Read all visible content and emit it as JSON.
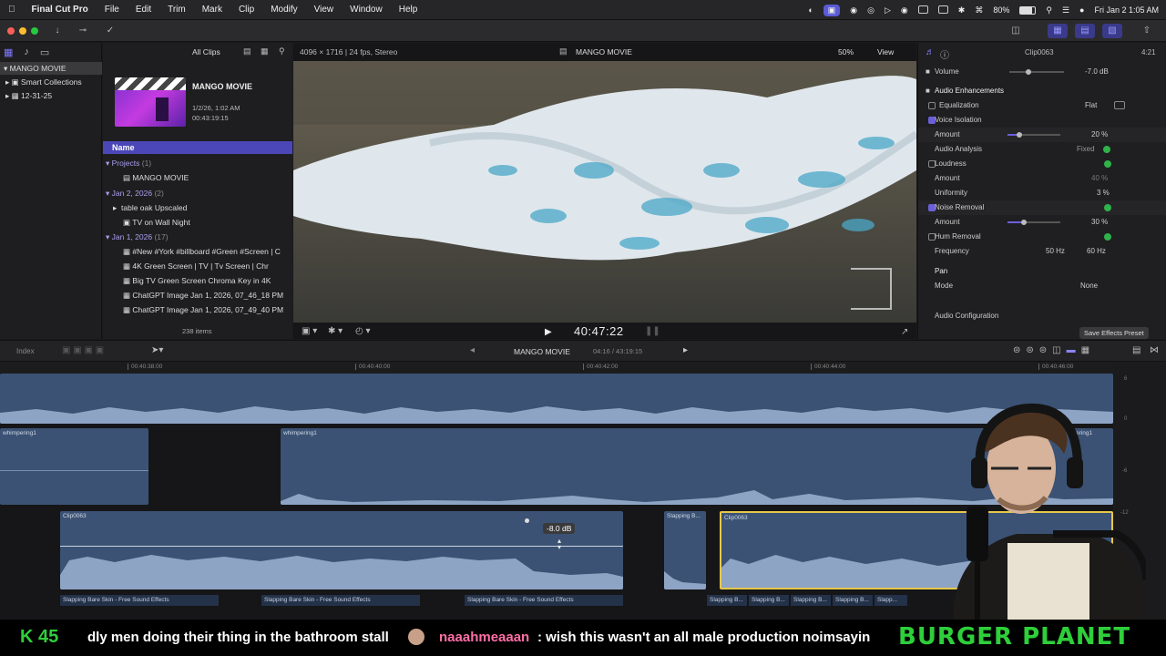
{
  "menubar": {
    "app_name": "Final Cut Pro",
    "items": [
      "File",
      "Edit",
      "Trim",
      "Mark",
      "Clip",
      "Modify",
      "View",
      "Window",
      "Help"
    ],
    "battery": "80%",
    "datetime": "Fri Jan 2  1:05 AM"
  },
  "library": {
    "title": "MANGO MOVIE",
    "items": [
      {
        "label": "MANGO MOVIE",
        "selected": true
      },
      {
        "label": "Smart Collections"
      },
      {
        "label": "12-31-25"
      }
    ]
  },
  "browser": {
    "filter_label": "All Clips",
    "project_title": "MANGO MOVIE",
    "project_date": "1/2/26, 1:02 AM",
    "project_duration": "00:43:19:15",
    "column_header": "Name",
    "groups": [
      {
        "label": "Projects",
        "count": "(1)",
        "items": [
          "MANGO MOVIE"
        ]
      },
      {
        "label": "Jan 2, 2026",
        "count": "(2)",
        "items": [
          "table oak Upscaled",
          "TV on Wall Night"
        ]
      },
      {
        "label": "Jan 1, 2026",
        "count": "(17)",
        "items": [
          "#New #York #billboard #Green #Screen | C",
          "4K Green Screen  |  TV  |  Tv Screen  |  Chr",
          "Big TV Green Screen Chroma Key in 4K",
          "ChatGPT Image Jan 1, 2026, 07_46_18 PM",
          "ChatGPT Image Jan 1, 2026, 07_49_40 PM"
        ]
      }
    ],
    "item_count": "238 items"
  },
  "viewer": {
    "format": "4096 × 1716 | 24 fps, Stereo",
    "title": "MANGO MOVIE",
    "zoom": "50%",
    "view_label": "View",
    "timecode": "40:47:22"
  },
  "inspector": {
    "clip_name": "Clip0063",
    "clip_duration": "4:21",
    "volume_label": "Volume",
    "volume_value": "-7.0  dB",
    "section": "Audio Enhancements",
    "equalization_label": "Equalization",
    "equalization_value": "Flat",
    "voice_isolation_label": "Voice Isolation",
    "amount_label": "Amount",
    "voice_amount": "20  %",
    "audio_analysis_label": "Audio Analysis",
    "audio_analysis_value": "Fixed",
    "loudness_label": "Loudness",
    "loudness_amount": "40  %",
    "uniformity_label": "Uniformity",
    "uniformity_value": "3  %",
    "noise_removal_label": "Noise Removal",
    "noise_amount": "30  %",
    "hum_removal_label": "Hum Removal",
    "frequency_label": "Frequency",
    "freq_50": "50 Hz",
    "freq_60": "60 Hz",
    "pan_label": "Pan",
    "mode_label": "Mode",
    "mode_value": "None",
    "audio_config_label": "Audio Configuration",
    "save_preset_label": "Save Effects Preset"
  },
  "timeline": {
    "index_label": "Index",
    "project_name": "MANGO MOVIE",
    "position": "04:16 / 43:19:15",
    "ruler": [
      "00:40:38:00",
      "00:40:40:00",
      "00:40:42:00",
      "00:40:44:00",
      "00:40:46:00"
    ],
    "clips": {
      "whimper_1": "whimpering1",
      "whimper_2": "whimpering1",
      "whimper_3": "mpering1",
      "clip_a": "Clip0063",
      "slapping_short": "Slapping B...",
      "clip_b": "Clip0063"
    },
    "volume_readout": "-8.0 dB",
    "sfx": [
      "Slapping Bare Skin - Free Sound Effects",
      "Slapping Bare Skin - Free Sound Effects",
      "Slapping Bare Skin - Free Sound Effects",
      "Slapping B...",
      "Slapping B...",
      "Slapping B...",
      "Slapping B...",
      "Slapp..."
    ],
    "meter_scale": [
      "6",
      "0",
      "-6",
      "-12"
    ]
  },
  "ticker": {
    "left_text": "K 45",
    "message_1": "dly men doing their thing in the bathroom stall",
    "username": "naaahmeaaan",
    "message_2": ": wish this wasn't an all male production noimsayin",
    "brand": "BURGER PLANET"
  },
  "colors": {
    "accent": "#6b5fd8",
    "clip_blue": "#3b5274",
    "selection_yellow": "#e6c84a",
    "ticker_green": "#2ecf3a",
    "username_pink": "#ff6fa6"
  }
}
